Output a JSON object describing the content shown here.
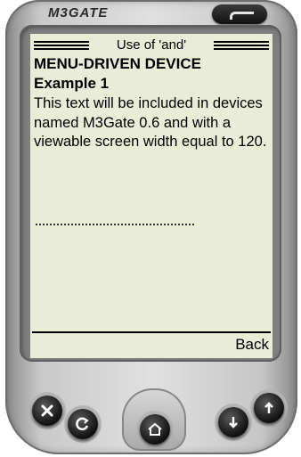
{
  "device": {
    "brand": "M3GATE"
  },
  "screen": {
    "title": "Use of 'and'",
    "heading": "MENU-DRIVEN DEVICE",
    "subheading": "Example 1",
    "body": "This text will be included in devices named M3Gate 0.6 and with a viewable screen width equal to 120.",
    "softkey_back": "Back"
  },
  "hardware_buttons": [
    {
      "name": "close",
      "icon": "close-icon"
    },
    {
      "name": "refresh",
      "icon": "refresh-icon"
    },
    {
      "name": "home",
      "icon": "home-icon"
    },
    {
      "name": "scroll-down",
      "icon": "arrow-down-icon"
    },
    {
      "name": "scroll-up",
      "icon": "arrow-up-icon"
    }
  ]
}
